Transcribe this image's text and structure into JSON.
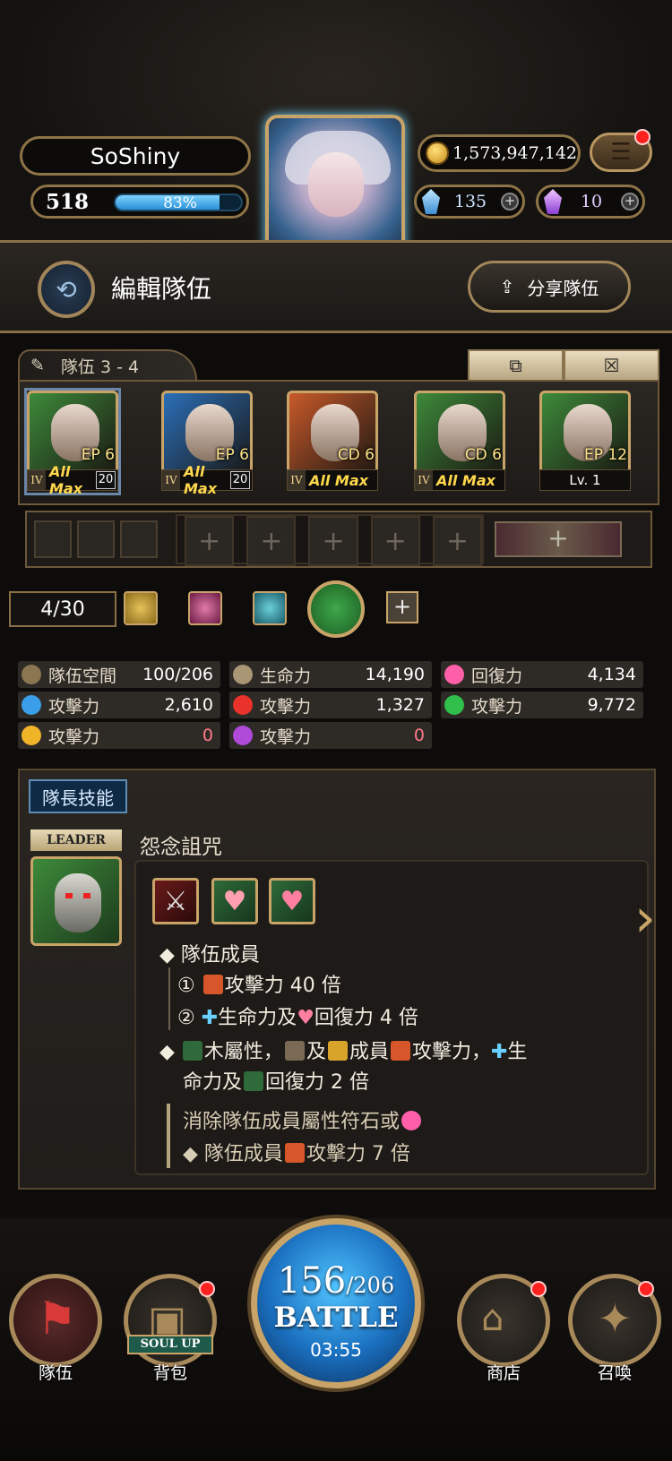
{
  "player": {
    "name": "SoShiny",
    "level": "518",
    "exp_text": "83%",
    "exp_fraction": 0.83
  },
  "currency": {
    "coins": "1,573,947,142",
    "diamonds": "135",
    "soul_gems": "10"
  },
  "page": {
    "title": "編輯隊伍",
    "share_label": "分享隊伍"
  },
  "team": {
    "tab_label": "隊伍 3 - 4",
    "cards": [
      {
        "badge": "EP 6",
        "tier": "IV",
        "status": "All Max",
        "level_badge": "20",
        "color": "#3d8a3a"
      },
      {
        "badge": "EP 6",
        "tier": "IV",
        "status": "All Max",
        "level_badge": "20",
        "color": "#2a6fb8"
      },
      {
        "badge": "CD 6",
        "tier": "IV",
        "status": "All Max",
        "level_badge": "",
        "color": "#c85a2a"
      },
      {
        "badge": "CD 6",
        "tier": "IV",
        "status": "All Max",
        "level_badge": "",
        "color": "#3d8a3a"
      },
      {
        "badge": "EP 12",
        "tier": "",
        "status": "Lv. 1",
        "level_badge": "",
        "color": "#3d8a3a"
      }
    ]
  },
  "filter": {
    "count": "4/30"
  },
  "stats": [
    {
      "label": "隊伍空間",
      "value": "100/206",
      "icon_color": "#8a7650"
    },
    {
      "label": "生命力",
      "value": "14,190",
      "icon_color": "#a89674"
    },
    {
      "label": "回復力",
      "value": "4,134",
      "icon_color": "#ff5fa8"
    },
    {
      "label": "攻擊力",
      "value": "2,610",
      "icon_color": "#3a9fe8"
    },
    {
      "label": "攻擊力",
      "value": "1,327",
      "icon_color": "#e8322a"
    },
    {
      "label": "攻擊力",
      "value": "9,772",
      "icon_color": "#2fbf4a"
    },
    {
      "label": "攻擊力",
      "value": "0",
      "icon_color": "#f0b429"
    },
    {
      "label": "攻擊力",
      "value": "0",
      "icon_color": "#b04ad8"
    }
  ],
  "leader": {
    "tab_label": "隊長技能",
    "badge": "LEADER",
    "skill_name": "怨念詛咒",
    "lines": {
      "l1": "隊伍成員",
      "l2_num": "①",
      "l2": "攻擊力 40 倍",
      "l3_num": "②",
      "l3a": "生命力及",
      "l3b": "回復力 4 倍",
      "l4a": "木屬性，",
      "l4b": "及",
      "l4c": "成員",
      "l4d": "攻擊力，",
      "l4e": "生",
      "l5a": "命力及",
      "l5b": "回復力 2 倍",
      "l6": "消除隊伍成員屬性符石或",
      "l7a": "隊伍成員",
      "l7b": "攻擊力 7 倍"
    }
  },
  "battle": {
    "stamina": "156",
    "stamina_max": "/206",
    "label": "BATTLE",
    "timer": "03:55"
  },
  "nav": {
    "team": "隊伍",
    "bag": "背包",
    "soul_up": "SOUL UP",
    "shop": "商店",
    "summon": "召喚"
  }
}
